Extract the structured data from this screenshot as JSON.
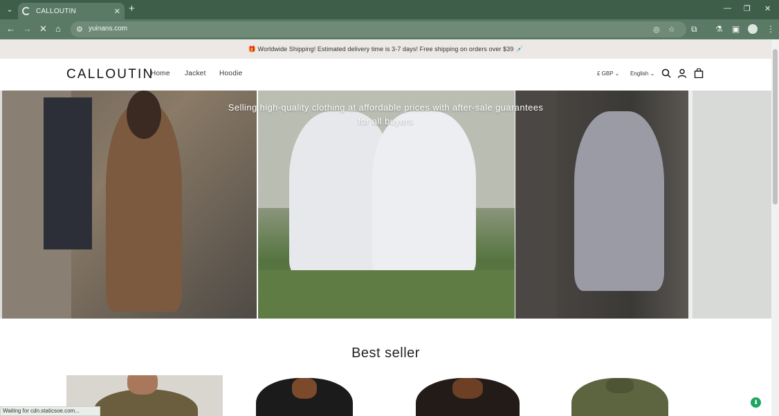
{
  "browser": {
    "tab_title": "CALLOUTIN",
    "url": "yuinans.com",
    "status_text": "Waiting for cdn.staticsoe.com..."
  },
  "announcement": "🎁 Worldwide Shipping! Estimated delivery time is 3-7 days! Free shipping on orders over $39 💉",
  "header": {
    "logo": "CALLOUTIN",
    "nav": [
      "Home",
      "Jacket",
      "Hoodie"
    ],
    "currency": "£ GBP",
    "language": "English"
  },
  "hero": {
    "text": "Selling high-quality clothing at affordable prices with after-sale guarantees for all buyers"
  },
  "best_seller": {
    "title": "Best seller"
  },
  "colors": {
    "browser_frame": "#3f5e4a",
    "toolbar": "#5b7a66",
    "announcement_bg": "#ebe8e5",
    "accent_green": "#1fa462"
  }
}
